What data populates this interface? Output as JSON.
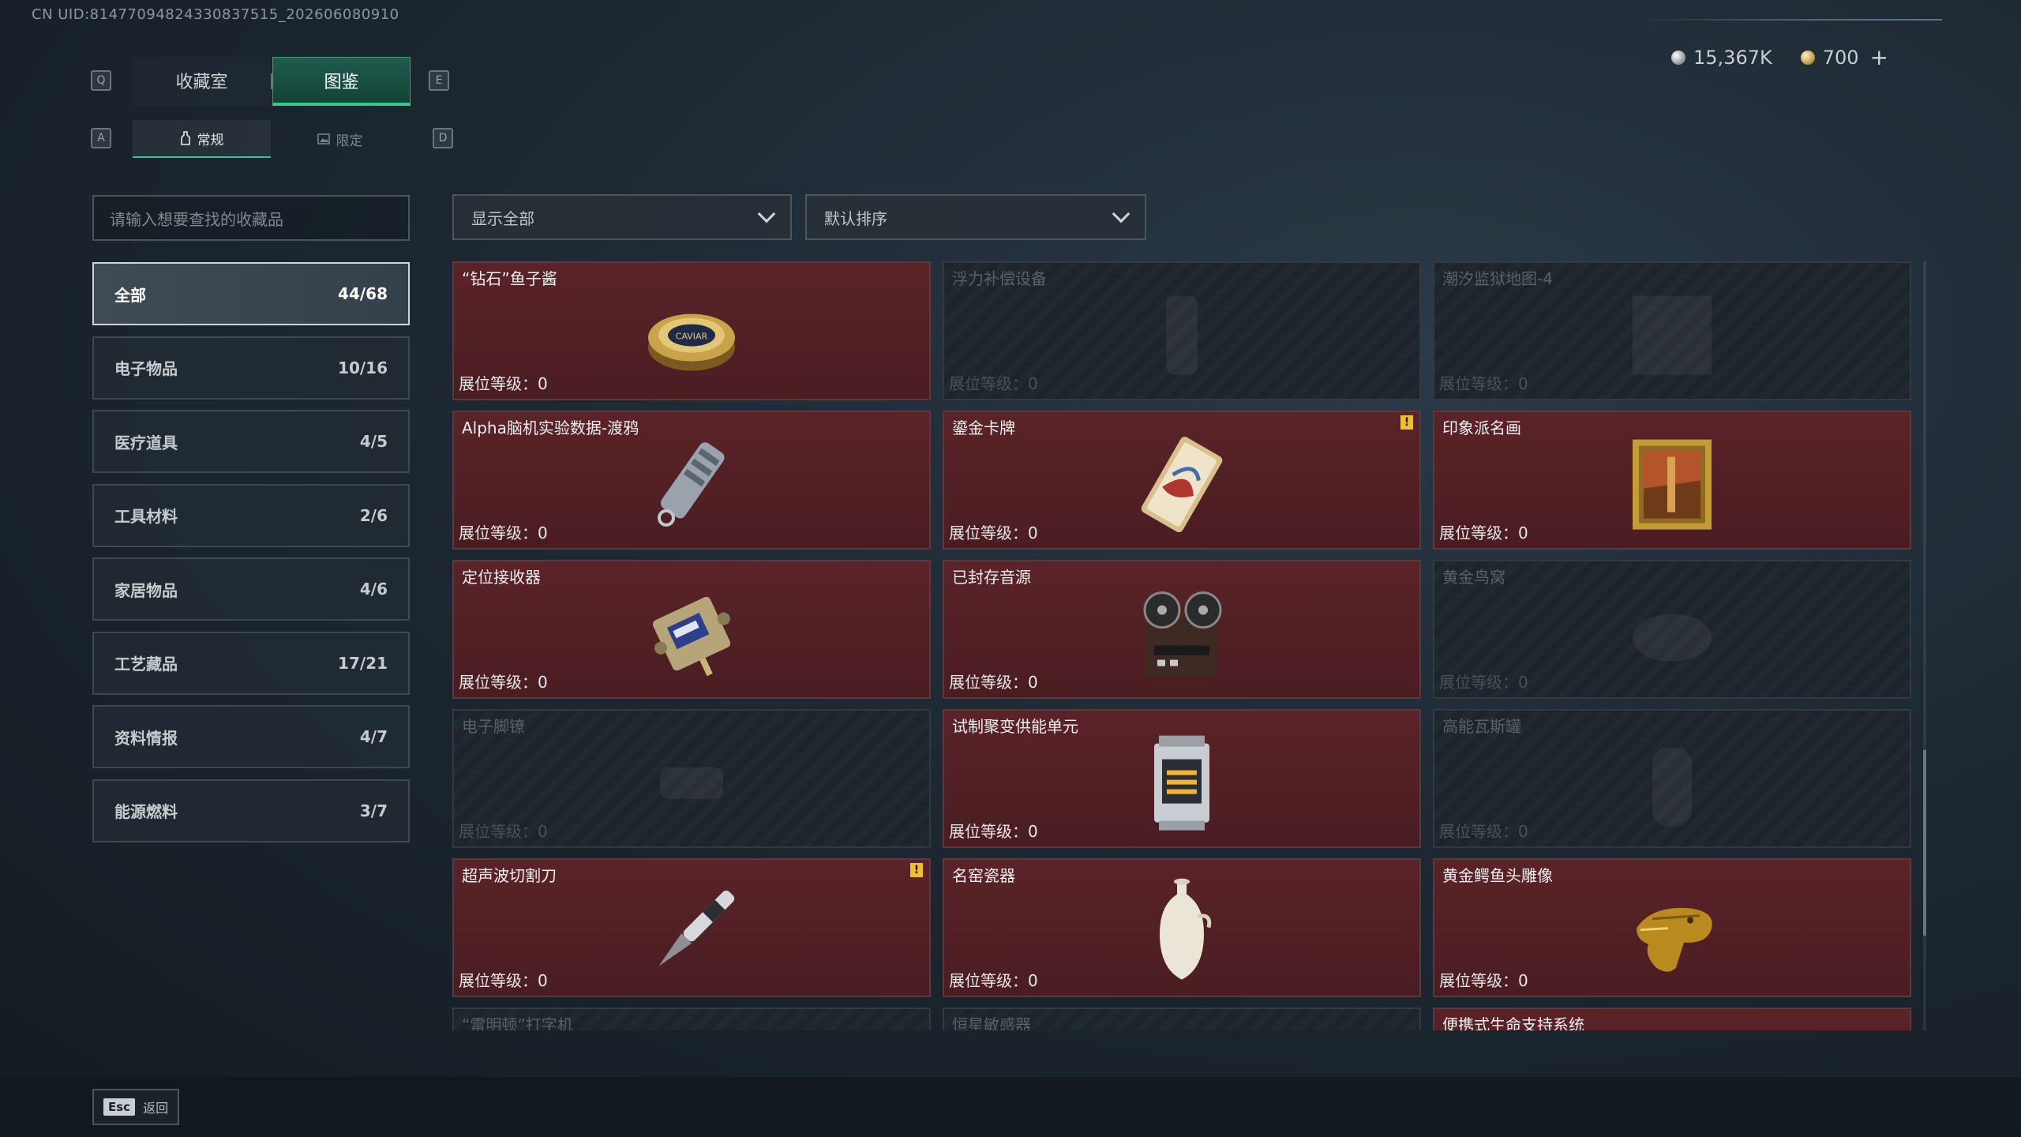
{
  "uid_text": "CN UID:814770948243308375​15_202606080910",
  "currency": {
    "silver": "15,367K",
    "gold": "700",
    "plus": "+"
  },
  "keys": {
    "q": "Q",
    "e": "E",
    "a": "A",
    "d": "D"
  },
  "tabs": [
    {
      "label": "收藏室"
    },
    {
      "label": "图鉴"
    }
  ],
  "subtabs": [
    {
      "label": "常规"
    },
    {
      "label": "限定"
    }
  ],
  "search": {
    "placeholder": "请输入想要查找的收藏品"
  },
  "filters": {
    "show": "显示全部",
    "sort": "默认排序"
  },
  "categories": [
    {
      "label": "全部",
      "count": "44/68"
    },
    {
      "label": "电子物品",
      "count": "10/16"
    },
    {
      "label": "医疗道具",
      "count": "4/5"
    },
    {
      "label": "工具材料",
      "count": "2/6"
    },
    {
      "label": "家居物品",
      "count": "4/6"
    },
    {
      "label": "工艺藏品",
      "count": "17/21"
    },
    {
      "label": "资料情报",
      "count": "4/7"
    },
    {
      "label": "能源燃料",
      "count": "3/7"
    }
  ],
  "level_label": "展位等级：0",
  "items": [
    {
      "name": "“钻石”鱼子酱",
      "collected": true,
      "icon": "caviar-tin-icon"
    },
    {
      "name": "浮力补偿设备",
      "collected": false,
      "icon": "buoyancy-device-icon"
    },
    {
      "name": "潮汐监狱地图-4",
      "collected": false,
      "icon": "map-icon"
    },
    {
      "name": "Alpha脑机实验数据-渡鸦",
      "collected": true,
      "icon": "data-drive-icon"
    },
    {
      "name": "鎏金卡牌",
      "collected": true,
      "icon": "gilded-card-icon",
      "alert": "!"
    },
    {
      "name": "印象派名画",
      "collected": true,
      "icon": "painting-icon"
    },
    {
      "name": "定位接收器",
      "collected": true,
      "icon": "receiver-icon"
    },
    {
      "name": "已封存音源",
      "collected": true,
      "icon": "tape-recorder-icon"
    },
    {
      "name": "黄金鸟窝",
      "collected": false,
      "icon": "bird-nest-icon"
    },
    {
      "name": "电子脚镣",
      "collected": false,
      "icon": "ankle-monitor-icon"
    },
    {
      "name": "试制聚变供能单元",
      "collected": true,
      "icon": "fusion-cell-icon"
    },
    {
      "name": "高能瓦斯罐",
      "collected": false,
      "icon": "gas-tank-icon"
    },
    {
      "name": "超声波切割刀",
      "collected": true,
      "icon": "ultrasonic-cutter-icon",
      "alert": "!"
    },
    {
      "name": "名窑瓷器",
      "collected": true,
      "icon": "porcelain-vase-icon"
    },
    {
      "name": "黄金鳄鱼头雕像",
      "collected": true,
      "icon": "gold-crocodile-icon"
    },
    {
      "name": "“雷明顿”打字机",
      "collected": false,
      "icon": "typewriter-icon"
    },
    {
      "name": "恒星敏感器",
      "collected": false,
      "icon": "star-sensor-icon"
    },
    {
      "name": "便携式生命支持系统",
      "collected": true,
      "icon": "life-support-icon"
    }
  ],
  "footer": {
    "esc_key": "Esc",
    "back_label": "返回"
  },
  "colors": {
    "accent": "#35c98f",
    "card_collected": "#4a1d22",
    "card_locked": "#1d242b"
  }
}
